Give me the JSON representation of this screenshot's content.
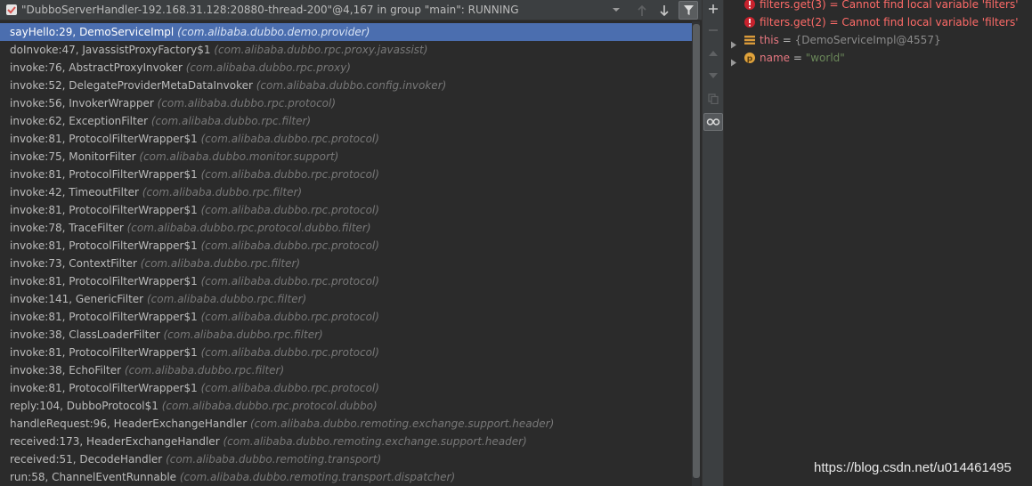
{
  "thread": {
    "title": "\"DubboServerHandler-192.168.31.128:20880-thread-200\"@4,167 in group \"main\": RUNNING"
  },
  "frames": [
    {
      "method": "sayHello:29, DemoServiceImpl",
      "pkg": "(com.alibaba.dubbo.demo.provider)"
    },
    {
      "method": "doInvoke:47, JavassistProxyFactory$1",
      "pkg": "(com.alibaba.dubbo.rpc.proxy.javassist)"
    },
    {
      "method": "invoke:76, AbstractProxyInvoker",
      "pkg": "(com.alibaba.dubbo.rpc.proxy)"
    },
    {
      "method": "invoke:52, DelegateProviderMetaDataInvoker",
      "pkg": "(com.alibaba.dubbo.config.invoker)"
    },
    {
      "method": "invoke:56, InvokerWrapper",
      "pkg": "(com.alibaba.dubbo.rpc.protocol)"
    },
    {
      "method": "invoke:62, ExceptionFilter",
      "pkg": "(com.alibaba.dubbo.rpc.filter)"
    },
    {
      "method": "invoke:81, ProtocolFilterWrapper$1",
      "pkg": "(com.alibaba.dubbo.rpc.protocol)"
    },
    {
      "method": "invoke:75, MonitorFilter",
      "pkg": "(com.alibaba.dubbo.monitor.support)"
    },
    {
      "method": "invoke:81, ProtocolFilterWrapper$1",
      "pkg": "(com.alibaba.dubbo.rpc.protocol)"
    },
    {
      "method": "invoke:42, TimeoutFilter",
      "pkg": "(com.alibaba.dubbo.rpc.filter)"
    },
    {
      "method": "invoke:81, ProtocolFilterWrapper$1",
      "pkg": "(com.alibaba.dubbo.rpc.protocol)"
    },
    {
      "method": "invoke:78, TraceFilter",
      "pkg": "(com.alibaba.dubbo.rpc.protocol.dubbo.filter)"
    },
    {
      "method": "invoke:81, ProtocolFilterWrapper$1",
      "pkg": "(com.alibaba.dubbo.rpc.protocol)"
    },
    {
      "method": "invoke:73, ContextFilter",
      "pkg": "(com.alibaba.dubbo.rpc.filter)"
    },
    {
      "method": "invoke:81, ProtocolFilterWrapper$1",
      "pkg": "(com.alibaba.dubbo.rpc.protocol)"
    },
    {
      "method": "invoke:141, GenericFilter",
      "pkg": "(com.alibaba.dubbo.rpc.filter)"
    },
    {
      "method": "invoke:81, ProtocolFilterWrapper$1",
      "pkg": "(com.alibaba.dubbo.rpc.protocol)"
    },
    {
      "method": "invoke:38, ClassLoaderFilter",
      "pkg": "(com.alibaba.dubbo.rpc.filter)"
    },
    {
      "method": "invoke:81, ProtocolFilterWrapper$1",
      "pkg": "(com.alibaba.dubbo.rpc.protocol)"
    },
    {
      "method": "invoke:38, EchoFilter",
      "pkg": "(com.alibaba.dubbo.rpc.filter)"
    },
    {
      "method": "invoke:81, ProtocolFilterWrapper$1",
      "pkg": "(com.alibaba.dubbo.rpc.protocol)"
    },
    {
      "method": "reply:104, DubboProtocol$1",
      "pkg": "(com.alibaba.dubbo.rpc.protocol.dubbo)"
    },
    {
      "method": "handleRequest:96, HeaderExchangeHandler",
      "pkg": "(com.alibaba.dubbo.remoting.exchange.support.header)"
    },
    {
      "method": "received:173, HeaderExchangeHandler",
      "pkg": "(com.alibaba.dubbo.remoting.exchange.support.header)"
    },
    {
      "method": "received:51, DecodeHandler",
      "pkg": "(com.alibaba.dubbo.remoting.transport)"
    },
    {
      "method": "run:58, ChannelEventRunnable",
      "pkg": "(com.alibaba.dubbo.remoting.transport.dispatcher)"
    }
  ],
  "selected_frame": 0,
  "variables": {
    "errors": [
      {
        "expr": "filters.get(3)",
        "eq": " = ",
        "msg": "Cannot find local variable 'filters'"
      },
      {
        "expr": "filters.get(2)",
        "eq": " = ",
        "msg": "Cannot find local variable 'filters'"
      }
    ],
    "this_var": {
      "name": "this",
      "eq": " = ",
      "value": "{DemoServiceImpl@4557}"
    },
    "name_var": {
      "name": "name",
      "eq": " = ",
      "value": "\"world\""
    }
  },
  "watermark": "https://blog.csdn.net/u014461495",
  "icons": {
    "thread": "thread-status-icon",
    "dropdown": "chevron-down-icon",
    "up": "arrow-up-icon",
    "down": "arrow-down-icon",
    "filter": "filter-icon",
    "add": "plus-icon",
    "minus": "minus-icon",
    "error": "error-icon",
    "field": "field-icon",
    "param": "parameter-icon"
  },
  "colors": {
    "selection": "#4b6eaf",
    "error": "#ff6b68",
    "string": "#6a8759",
    "param_badge": "#e0a33c"
  }
}
